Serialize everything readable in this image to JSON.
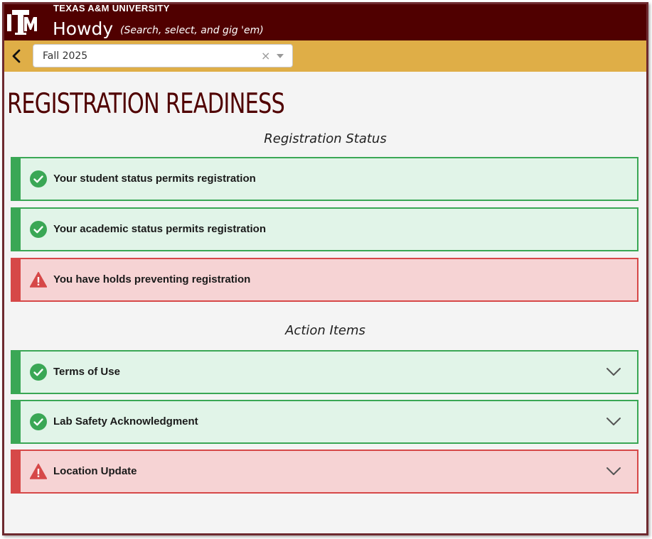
{
  "header": {
    "logo_alt": "ATM",
    "university": "TEXAS A&M UNIVERSITY",
    "app_name": "Howdy",
    "tagline": "(Search, select, and gig 'em)"
  },
  "term_selector": {
    "selected": "Fall 2025",
    "clear_glyph": "×"
  },
  "page": {
    "title": "REGISTRATION READINESS"
  },
  "registration_status": {
    "heading": "Registration Status",
    "items": [
      {
        "label": "Your student status permits registration",
        "state": "ok"
      },
      {
        "label": "Your academic status permits registration",
        "state": "ok"
      },
      {
        "label": "You have holds preventing registration",
        "state": "warning"
      }
    ]
  },
  "action_items": {
    "heading": "Action Items",
    "items": [
      {
        "label": "Terms of Use",
        "state": "ok"
      },
      {
        "label": "Lab Safety Acknowledgment",
        "state": "ok"
      },
      {
        "label": "Location Update",
        "state": "warning"
      }
    ]
  },
  "colors": {
    "maroon": "#500000",
    "gold": "#dfae47",
    "success": "#3aa755",
    "success_bg": "#e1f4e8",
    "danger": "#d64848",
    "danger_bg": "#f6d3d4"
  },
  "icons": {
    "ok": "check-circle-icon",
    "warning": "warning-triangle-icon",
    "expand": "chevron-down-icon",
    "back": "chevron-left-icon"
  }
}
